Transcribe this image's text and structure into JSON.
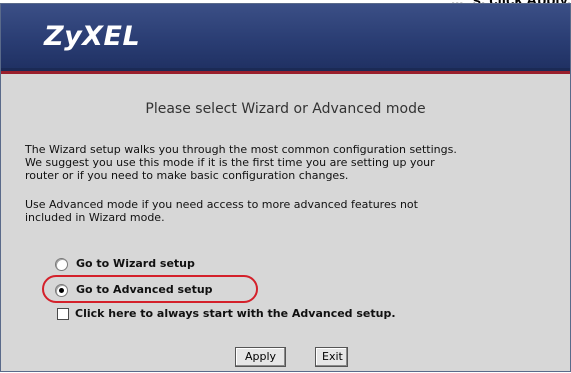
{
  "top_fragment": "... ;s, click Apply.",
  "header": {
    "logo_text": "ZyXEL"
  },
  "content": {
    "title": "Please select Wizard or Advanced mode",
    "para1": "The Wizard setup walks you through the most common configuration settings.\nWe suggest you use this mode if it is the first time you are setting up your\nrouter or if you need to make basic configuration changes.",
    "para2": "Use Advanced mode if you need access to more advanced features not\nincluded in Wizard mode.",
    "options": [
      {
        "label": "Go to Wizard setup",
        "checked": false
      },
      {
        "label": "Go to Advanced setup",
        "checked": true
      }
    ],
    "checkbox": {
      "label": "Click here to always start with the Advanced setup.",
      "checked": false
    }
  },
  "buttons": {
    "apply": "Apply",
    "exit": "Exit"
  },
  "colors": {
    "header_bg": "#2a3d73",
    "header_accent": "#9a1f2c",
    "content_bg": "#d7d7d7",
    "highlight": "#d4202a"
  }
}
